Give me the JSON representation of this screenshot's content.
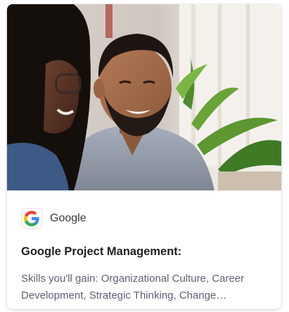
{
  "card": {
    "partner": {
      "logo_icon": "google-g-logo",
      "name": "Google"
    },
    "title": "Google Project Management:",
    "skills_line1": "Skills you'll gain: Organizational Culture, Career",
    "skills_line2": "Development, Strategic Thinking, Change…",
    "image_description_icon": "course-hero-photo"
  },
  "colors": {
    "title_text": "#1f1f1f",
    "body_text": "#5b6270",
    "google_blue": "#4285F4",
    "google_red": "#EA4335",
    "google_yellow": "#FBBC05",
    "google_green": "#34A853"
  }
}
